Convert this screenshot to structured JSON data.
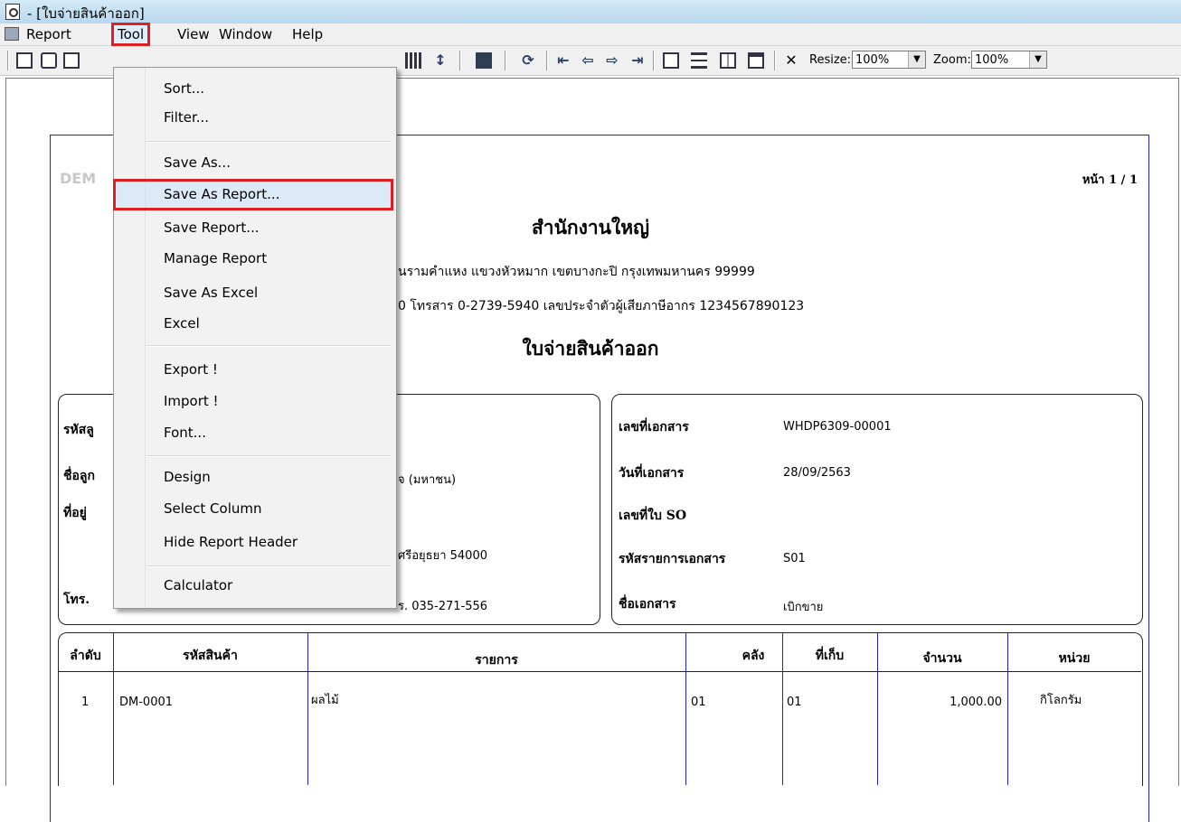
{
  "window": {
    "title": "- [ใบจ่ายสินค้าออก]"
  },
  "menubar": {
    "items": [
      "Report",
      "Tool",
      "View",
      "Window",
      "Help"
    ]
  },
  "toolbar": {
    "resize_label": "Resize:",
    "resize_value": "100%",
    "zoom_label": "Zoom:",
    "zoom_value": "100%"
  },
  "tool_menu": {
    "items": [
      "Sort...",
      "Filter...",
      "Save As...",
      "Save As Report...",
      "Save Report...",
      "Manage Report",
      "Save As Excel",
      "Excel",
      "Export !",
      "Import !",
      "Font...",
      "Design",
      "Select Column",
      "Hide Report Header",
      "Calculator"
    ],
    "highlighted": "Save As Report..."
  },
  "report": {
    "demo": "DEM",
    "page": "หน้า 1 / 1",
    "company": "สำนักงานใหญ่",
    "address_line1": "นรามคำแหง แขวงหัวหมาก เขตบางกะปิ กรุงเทพมหานคร 99999",
    "address_line2": "0  โทรสาร 0-2739-5940  เลขประจำตัวผู้เสียภาษีอากร 1234567890123",
    "doc_title": "ใบจ่ายสินค้าออก",
    "left_box": {
      "code_label": "รหัสลู",
      "name_label": "ชื่อลูก",
      "addr_label": "ที่อยู่",
      "tel_label": "โทร.",
      "name_value": "จ (มหาชน)",
      "addr_value": "ศรีอยุธยา  54000",
      "fax_value": "ร. 035-271-556"
    },
    "right_box": {
      "doc_no_label": "เลขที่เอกสาร",
      "doc_no_value": "WHDP6309-00001",
      "doc_date_label": "วันที่เอกสาร",
      "doc_date_value": "28/09/2563",
      "so_label": "เลขที่ใบ SO",
      "item_code_label": "รหัสรายการเอกสาร",
      "item_code_value": "S01",
      "doc_name_label": "ชื่อเอกสาร",
      "doc_name_value": "เบิกขาย"
    },
    "table": {
      "headers": [
        "ลำดับ",
        "รหัสสินค้า",
        "รายการ",
        "คลัง",
        "ที่เก็บ",
        "จำนวน",
        "หน่วย"
      ],
      "rows": [
        [
          "1",
          "DM-0001",
          "ผลไม้",
          "01",
          "01",
          "1,000.00",
          "กิโลกรัม"
        ]
      ]
    }
  }
}
